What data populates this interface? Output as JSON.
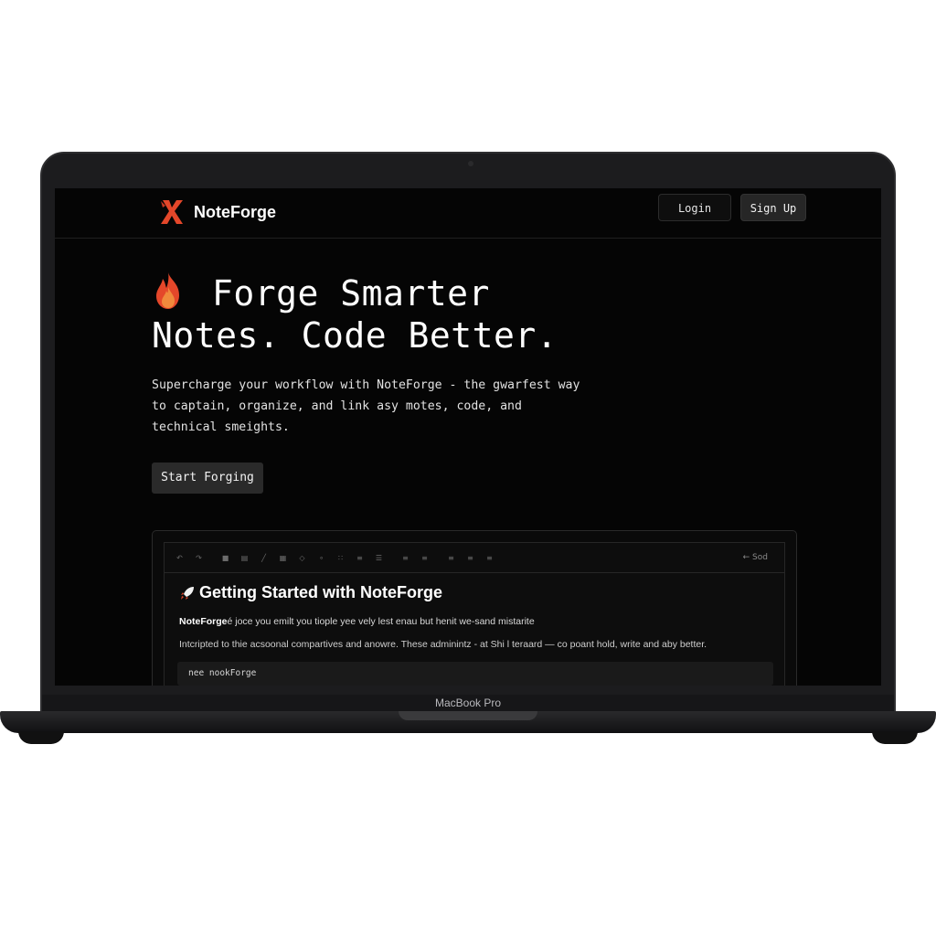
{
  "nav": {
    "brand": "NoteForge",
    "login_label": "Login",
    "signup_label": "Sign Up"
  },
  "hero": {
    "title_line1": "Forge Smarter",
    "title_line2": "Notes. Code Better.",
    "subtitle": "Supercharge your workflow with NoteForge - the gwarfest way to captain, organize, and link asy motes, code, and technical smeights.",
    "cta_label": "Start Forging"
  },
  "editor": {
    "toolbar_right": "← Sod",
    "doc_title": "Getting Started with NoteForge",
    "line1_bold": "NoteForge",
    "line1_rest": "é joce you emilt you tiople yee vely lest enau but henit we-sand mistarite",
    "line2": "Intcripted to thie acsoonal compartives and anowre. These adminintz - at Shi l teraard — co poant hold, write and aby better.",
    "code": "nee nookForge"
  },
  "device": {
    "model": "MacBook Pro"
  },
  "icons": {
    "brand": "noteforge-x-logo-icon",
    "hero": "flame-icon",
    "doc": "rocket-icon"
  },
  "colors": {
    "accent": "#e4472a",
    "background": "#050505"
  }
}
